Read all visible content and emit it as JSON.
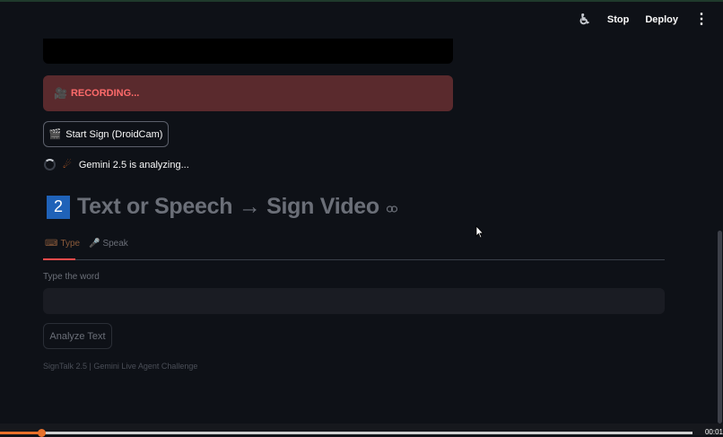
{
  "header": {
    "run_icon": "running-man-icon",
    "stop_label": "Stop",
    "deploy_label": "Deploy",
    "menu_icon": "kebab-menu-icon"
  },
  "recording_alert": {
    "icon": "🎥",
    "text": "RECORDING..."
  },
  "start_button": {
    "icon": "🎬",
    "label": "Start Sign (DroidCam)"
  },
  "status": {
    "icon": "☄",
    "text": "Gemini 2.5 is analyzing..."
  },
  "section": {
    "number": "2",
    "title": "Text or Speech → Sign Video",
    "link_icon": "⛓"
  },
  "tabs": [
    {
      "icon": "⌨",
      "label": "Type",
      "active": true
    },
    {
      "icon": "🎤",
      "label": "Speak",
      "active": false
    }
  ],
  "input": {
    "label": "Type the word",
    "value": "",
    "placeholder": ""
  },
  "analyze_button": {
    "label": "Analyze Text"
  },
  "footer": {
    "text": "SignTalk 2.5 | Gemini Live Agent Challenge"
  },
  "video_player": {
    "time": "00:01",
    "progress_fraction": 0.06
  },
  "colors": {
    "background": "#0e1117",
    "alert_bg": "#5a2a2d",
    "alert_text": "#ff6b6b",
    "section_badge": "#1f62b8",
    "tab_accent": "#ff4b4b",
    "progress": "#e8712b"
  }
}
